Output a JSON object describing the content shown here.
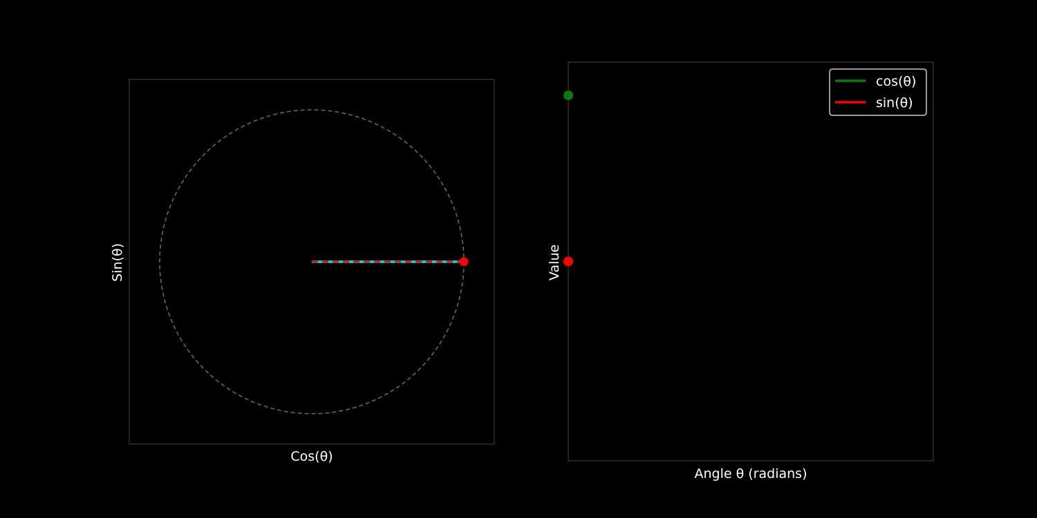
{
  "colors": {
    "background": "#000000",
    "frame": "#3a3a3a",
    "unit_circle": "#666666",
    "radius_line": "#00e5e5",
    "cos_projection": "#ff0000",
    "cos_series": "#0a7a0a",
    "sin_series": "#ff0000",
    "text": "#ffffff"
  },
  "chart_data": [
    {
      "type": "scatter",
      "xlabel": "Cos(θ)",
      "ylabel": "Sin(θ)",
      "xlim": [
        -1.2,
        1.2
      ],
      "ylim": [
        -1.2,
        1.2
      ],
      "grid": false,
      "unit_circle": {
        "radius": 1.0,
        "style": "dashed"
      },
      "angle_radians": 0.0,
      "point": {
        "x": 1.0,
        "y": 0.0
      },
      "radius_line": {
        "from": [
          0.0,
          0.0
        ],
        "to": [
          1.0,
          0.0
        ]
      }
    },
    {
      "type": "line",
      "xlabel": "Angle θ (radians)",
      "ylabel": "Value",
      "xlim": [
        0,
        6.283
      ],
      "ylim": [
        -1.2,
        1.2
      ],
      "grid": false,
      "legend_position": "top-right",
      "series": [
        {
          "name": "cos(θ)",
          "x": [
            0.0
          ],
          "values": [
            1.0
          ],
          "color": "#0a7a0a"
        },
        {
          "name": "sin(θ)",
          "x": [
            0.0
          ],
          "values": [
            0.0
          ],
          "color": "#ff0000"
        }
      ]
    }
  ]
}
